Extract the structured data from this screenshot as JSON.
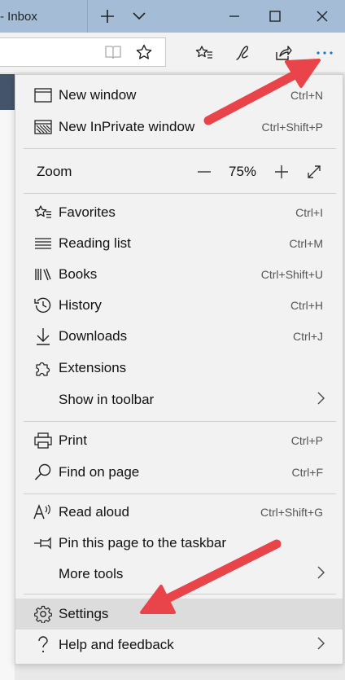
{
  "titlebar": {
    "tab_title": "- Inbox",
    "new_tab_symbol": "+"
  },
  "menu": {
    "group1": [
      {
        "label": "New window",
        "shortcut": "Ctrl+N",
        "icon": "window-icon"
      },
      {
        "label": "New InPrivate window",
        "shortcut": "Ctrl+Shift+P",
        "icon": "inprivate-icon"
      }
    ],
    "zoom": {
      "label": "Zoom",
      "value": "75%",
      "minus": "—",
      "plus": "+"
    },
    "group2": [
      {
        "label": "Favorites",
        "shortcut": "Ctrl+I",
        "icon": "favorites-icon"
      },
      {
        "label": "Reading list",
        "shortcut": "Ctrl+M",
        "icon": "reading-list-icon"
      },
      {
        "label": "Books",
        "shortcut": "Ctrl+Shift+U",
        "icon": "books-icon"
      },
      {
        "label": "History",
        "shortcut": "Ctrl+H",
        "icon": "history-icon"
      },
      {
        "label": "Downloads",
        "shortcut": "Ctrl+J",
        "icon": "downloads-icon"
      },
      {
        "label": "Extensions",
        "shortcut": "",
        "icon": "extensions-icon"
      },
      {
        "label": "Show in toolbar",
        "shortcut": "",
        "icon": ""
      }
    ],
    "group3": [
      {
        "label": "Print",
        "shortcut": "Ctrl+P",
        "icon": "print-icon"
      },
      {
        "label": "Find on page",
        "shortcut": "Ctrl+F",
        "icon": "search-icon"
      }
    ],
    "group4": [
      {
        "label": "Read aloud",
        "shortcut": "Ctrl+Shift+G",
        "icon": "read-aloud-icon"
      },
      {
        "label": "Pin this page to the taskbar",
        "shortcut": "",
        "icon": "pin-icon"
      },
      {
        "label": "More tools",
        "shortcut": "",
        "icon": ""
      }
    ],
    "group5": [
      {
        "label": "Settings",
        "shortcut": "",
        "icon": "gear-icon"
      },
      {
        "label": "Help and feedback",
        "shortcut": "",
        "icon": "help-icon"
      }
    ]
  },
  "colors": {
    "titlebar": "#a4bcd6",
    "menu_bg": "#f2f2f2",
    "highlight": "#dcdcdc",
    "arrow": "#e8444a",
    "more_accent": "#1a73c8"
  }
}
